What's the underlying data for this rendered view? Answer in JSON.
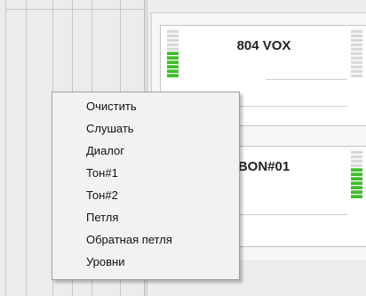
{
  "channels": [
    {
      "title": "804 VOX",
      "left_level": 6,
      "right_level": 0
    },
    {
      "title": "BON#01",
      "left_level": 0,
      "right_level": 7
    }
  ],
  "meter_segments": 11,
  "colors": {
    "meter_on": "#3fbe2c",
    "meter_off": "#d9d9d9",
    "menu_bg": "#f2f2f2"
  },
  "context_menu": {
    "items": [
      {
        "label": "Очистить"
      },
      {
        "label": "Слушать"
      },
      {
        "label": "Диалог"
      },
      {
        "label": "Тон#1"
      },
      {
        "label": "Тон#2"
      },
      {
        "label": "Петля"
      },
      {
        "label": "Обратная петля"
      },
      {
        "label": "Уровни"
      }
    ]
  }
}
